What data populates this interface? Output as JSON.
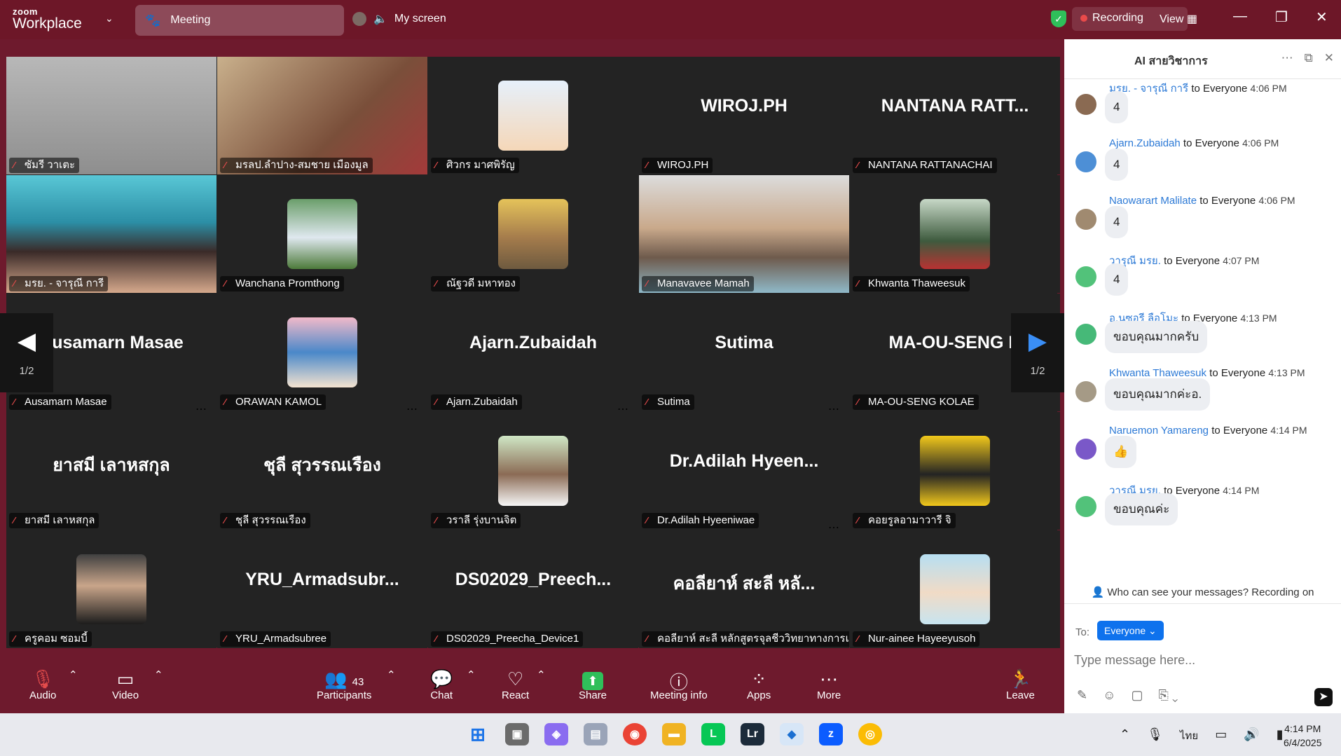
{
  "titlebar": {
    "logo_small": "zoom",
    "logo_big": "Workplace",
    "meeting_tab": "Meeting",
    "my_screen": "My screen",
    "recording": "Recording",
    "view": "View"
  },
  "gallery": {
    "page": "1/2",
    "tiles": [
      {
        "label": "ซัมรี วาเตะ",
        "big": ""
      },
      {
        "label": "มรลป.ลำปาง-สมชาย เมืองมูล",
        "big": ""
      },
      {
        "label": "ศิวกร มาศพิรัญ",
        "big": ""
      },
      {
        "label": "WIROJ.PH",
        "big": "WIROJ.PH"
      },
      {
        "label": "NANTANA RATTANACHAI",
        "big": "NANTANA  RATT..."
      },
      {
        "label": "มรย. - จารุณี การี",
        "big": ""
      },
      {
        "label": "Wanchana Promthong",
        "big": ""
      },
      {
        "label": "ณัฐวดี มหาทอง",
        "big": ""
      },
      {
        "label": "Manavavee Mamah",
        "big": ""
      },
      {
        "label": "Khwanta Thaweesuk",
        "big": ""
      },
      {
        "label": "Ausamarn Masae",
        "big": "Ausamarn Masae"
      },
      {
        "label": "ORAWAN KAMOL",
        "big": ""
      },
      {
        "label": "Ajarn.Zubaidah",
        "big": "Ajarn.Zubaidah"
      },
      {
        "label": "Sutima",
        "big": "Sutima"
      },
      {
        "label": "MA-OU-SENG KOLAE",
        "big": "MA-OU-SENG  K"
      },
      {
        "label": "ยาสมี เลาหสกุล",
        "big": "ยาสมี  เลาหสกุล"
      },
      {
        "label": "ชุลี สุวรรณเรือง",
        "big": "ชุลี  สุวรรณเรือง"
      },
      {
        "label": "วราลี รุ่งบานจิต",
        "big": ""
      },
      {
        "label": "Dr.Adilah Hyeeniwae",
        "big": "Dr.Adilah  Hyeen..."
      },
      {
        "label": "คอยรูลอามาวารี จิ",
        "big": ""
      },
      {
        "label": "ครูคอม ซอมบี้",
        "big": ""
      },
      {
        "label": "YRU_Armadsubree",
        "big": "YRU_Armadsubr..."
      },
      {
        "label": "DS02029_Preecha_Device1",
        "big": "DS02029_Preech..."
      },
      {
        "label": "คอลียาห์ สะลี  หลักสูตรจุลชีววิทยาทางการแพทย์",
        "big": "คอลียาห์  สะลี    หลั..."
      },
      {
        "label": "Nur-ainee Hayeeyusoh",
        "big": ""
      }
    ]
  },
  "chat": {
    "title": "AI สายวิชาการ",
    "messages": [
      {
        "name": "มรย. - จารุณี การี",
        "to": "to Everyone",
        "time": "4:06 PM",
        "text": "4"
      },
      {
        "name": "Ajarn.Zubaidah",
        "to": "to Everyone",
        "time": "4:06 PM",
        "text": "4"
      },
      {
        "name": "Naowarart Malilate",
        "to": "to Everyone",
        "time": "4:06 PM",
        "text": "4"
      },
      {
        "name": "วารุณี มรย.",
        "to": "to Everyone",
        "time": "4:07 PM",
        "text": "4"
      },
      {
        "name": "อ.นูซอรี ลือโมะ",
        "to": "to Everyone",
        "time": "4:13 PM",
        "text": "ขอบคุณมากครับ"
      },
      {
        "name": "Khwanta Thaweesuk",
        "to": "to Everyone",
        "time": "4:13 PM",
        "text": "ขอบคุณมากค่ะอ."
      },
      {
        "name": "Naruemon Yamareng",
        "to": "to Everyone",
        "time": "4:14 PM",
        "text": "👍"
      },
      {
        "name": "วารุณี มรย.",
        "to": "to Everyone",
        "time": "4:14 PM",
        "text": "ขอบคุณค่ะ"
      }
    ],
    "notice": "Who can see your messages? Recording on",
    "to_label": "To:",
    "recipient": "Everyone",
    "placeholder": "Type message here..."
  },
  "toolbar": {
    "audio": "Audio",
    "video": "Video",
    "participants": "Participants",
    "participant_count": "43",
    "chat": "Chat",
    "react": "React",
    "share": "Share",
    "meeting_info": "Meeting info",
    "apps": "Apps",
    "more": "More",
    "leave": "Leave"
  },
  "taskbar": {
    "lang": "ไทย",
    "time": "4:14 PM",
    "date": "6/4/2025"
  },
  "colors": {
    "title_bg": "#6d1728",
    "accent_blue": "#0e72ed",
    "active_speaker": "#39d98a",
    "muted_red": "#e34b4b"
  }
}
